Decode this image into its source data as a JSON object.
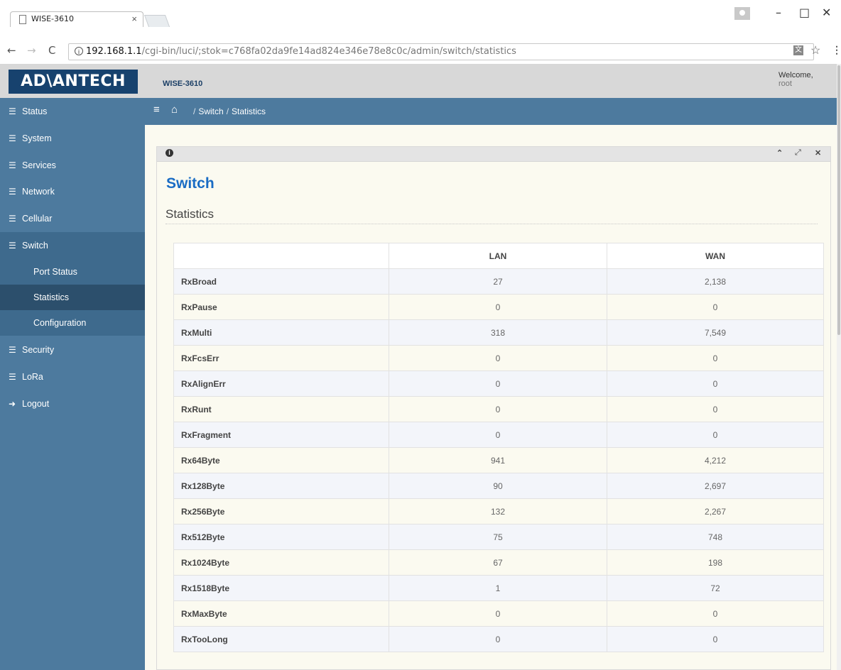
{
  "browser": {
    "tab_title": "WISE-3610",
    "tab_close": "×",
    "url_host": "192.168.1.1",
    "url_path": "/cgi-bin/luci/;stok=c768fa02da9fe14ad824e346e78e8c0c/admin/switch/statistics",
    "window_minimize": "–",
    "window_maximize": "□",
    "window_close": "✕"
  },
  "header": {
    "logo": "AD\\ANTECH",
    "device_name": "WISE-3610",
    "welcome_label": "Welcome,",
    "user": "root"
  },
  "sidebar": {
    "items": [
      {
        "label": "Status",
        "icon": "list-icon"
      },
      {
        "label": "System",
        "icon": "list-icon"
      },
      {
        "label": "Services",
        "icon": "list-icon"
      },
      {
        "label": "Network",
        "icon": "list-icon"
      },
      {
        "label": "Cellular",
        "icon": "list-icon"
      },
      {
        "label": "Switch",
        "icon": "list-icon"
      },
      {
        "label": "Security",
        "icon": "list-icon"
      },
      {
        "label": "LoRa",
        "icon": "list-icon"
      },
      {
        "label": "Logout",
        "icon": "logout-icon"
      }
    ],
    "switch_subitems": [
      "Port Status",
      "Statistics",
      "Configuration"
    ]
  },
  "breadcrumb": {
    "items": [
      "Switch",
      "Statistics"
    ],
    "separator": "/"
  },
  "page": {
    "title": "Switch",
    "section": "Statistics"
  },
  "table": {
    "columns": [
      "",
      "LAN",
      "WAN"
    ],
    "rows": [
      {
        "name": "RxBroad",
        "lan": "27",
        "wan": "2,138"
      },
      {
        "name": "RxPause",
        "lan": "0",
        "wan": "0"
      },
      {
        "name": "RxMulti",
        "lan": "318",
        "wan": "7,549"
      },
      {
        "name": "RxFcsErr",
        "lan": "0",
        "wan": "0"
      },
      {
        "name": "RxAlignErr",
        "lan": "0",
        "wan": "0"
      },
      {
        "name": "RxRunt",
        "lan": "0",
        "wan": "0"
      },
      {
        "name": "RxFragment",
        "lan": "0",
        "wan": "0"
      },
      {
        "name": "Rx64Byte",
        "lan": "941",
        "wan": "4,212"
      },
      {
        "name": "Rx128Byte",
        "lan": "90",
        "wan": "2,697"
      },
      {
        "name": "Rx256Byte",
        "lan": "132",
        "wan": "2,267"
      },
      {
        "name": "Rx512Byte",
        "lan": "75",
        "wan": "748"
      },
      {
        "name": "Rx1024Byte",
        "lan": "67",
        "wan": "198"
      },
      {
        "name": "Rx1518Byte",
        "lan": "1",
        "wan": "72"
      },
      {
        "name": "RxMaxByte",
        "lan": "0",
        "wan": "0"
      },
      {
        "name": "RxTooLong",
        "lan": "0",
        "wan": "0"
      }
    ]
  },
  "colors": {
    "sidebar": "#4d7a9e",
    "sidebar_active": "#2c4f6c",
    "logo_bg": "#17426e",
    "title_blue": "#1a6cc4",
    "content_bg": "#fbfaf0"
  }
}
